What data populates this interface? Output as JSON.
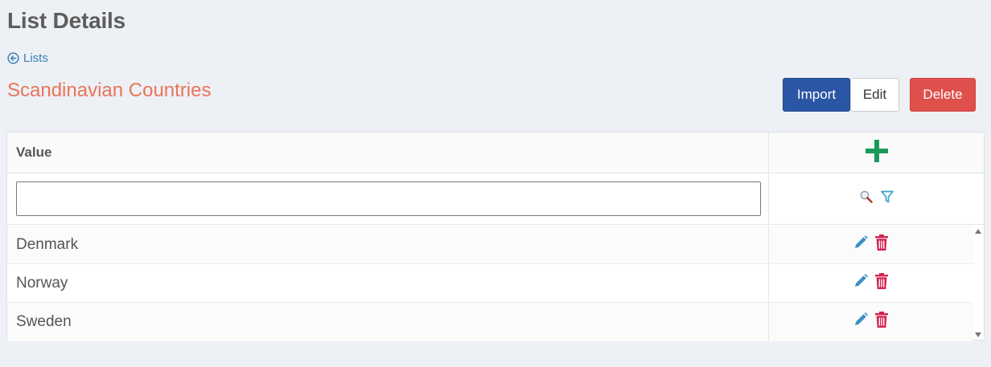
{
  "page": {
    "title": "List Details"
  },
  "back": {
    "label": "Lists",
    "icon": "arrow-circle-left-icon"
  },
  "list": {
    "name": "Scandinavian Countries"
  },
  "actions": {
    "import": "Import",
    "edit": "Edit",
    "delete": "Delete"
  },
  "grid": {
    "column_value": "Value",
    "add_icon": "plus-icon",
    "filter": {
      "value": "",
      "placeholder": ""
    },
    "rows": [
      {
        "value": "Denmark"
      },
      {
        "value": "Norway"
      },
      {
        "value": "Sweden"
      }
    ]
  },
  "colors": {
    "primary": "#2a56a5",
    "danger": "#df4f4b",
    "accent": "#e8755a",
    "link": "#3a7fb8",
    "add": "#1a9a5a",
    "edit_icon": "#3b8fc4",
    "trash_icon": "#d4224e"
  }
}
